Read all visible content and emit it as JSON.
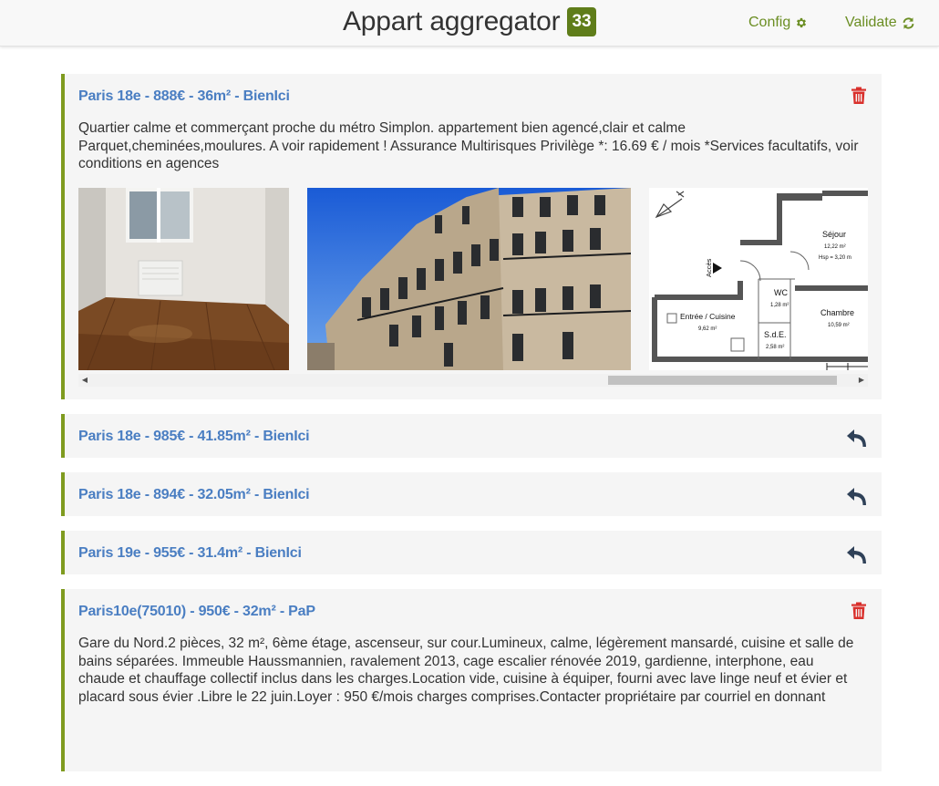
{
  "header": {
    "title": "Appart aggregator",
    "count": "33",
    "config_label": "Config",
    "validate_label": "Validate",
    "accent": "#6b8e23"
  },
  "listings": [
    {
      "title": "Paris 18e - 888€ - 36m² - BienIci",
      "action": "trash-icon",
      "expanded": true,
      "description": "Quartier calme et commerçant proche du métro Simplon. appartement bien agencé,clair et calme Parquet,cheminées,moulures. A voir rapidement ! Assurance Multirisques Privilège *: 16.69 € / mois *Services facultatifs, voir conditions en agences",
      "floorplan": {
        "sejour": "Séjour",
        "sejour_area": "12,22 m²",
        "sejour_hsp": "Hsp = 3,20 m",
        "wc": "WC",
        "wc_area": "1,28 m²",
        "entree": "Entrée / Cuisine",
        "entree_area": "9,62 m²",
        "chambre": "Chambre",
        "chambre_area": "10,59 m²",
        "sde": "S.d.E.",
        "sde_area": "2,58 m²",
        "acces": "Accès"
      }
    },
    {
      "title": "Paris 18e - 985€ - 41.85m² - BienIci",
      "action": "undo-icon",
      "expanded": false
    },
    {
      "title": "Paris 18e - 894€ - 32.05m² - BienIci",
      "action": "undo-icon",
      "expanded": false
    },
    {
      "title": "Paris 19e - 955€ - 31.4m² - BienIci",
      "action": "undo-icon",
      "expanded": false
    },
    {
      "title": "Paris10e(75010) - 950€ - 32m² - PaP",
      "action": "trash-icon",
      "expanded": true,
      "description": "Gare du Nord.2 pièces, 32 m², 6ème étage, ascenseur, sur cour.Lumineux, calme, légèrement mansardé, cuisine et salle de bains séparées. Immeuble Haussmannien, ravalement 2013, cage escalier rénovée 2019, gardienne, interphone, eau chaude et chauffage collectif inclus dans les charges.Location vide, cuisine à équiper, fourni avec lave linge neuf et évier et placard sous évier .Libre le 22 juin.Loyer : 950 €/mois charges comprises.Contacter propriétaire par courriel en donnant"
    }
  ],
  "colors": {
    "title_link": "#4a7ec2",
    "card_border": "#7f9b1f",
    "trash": "#d9302c",
    "undo": "#2f4158"
  }
}
